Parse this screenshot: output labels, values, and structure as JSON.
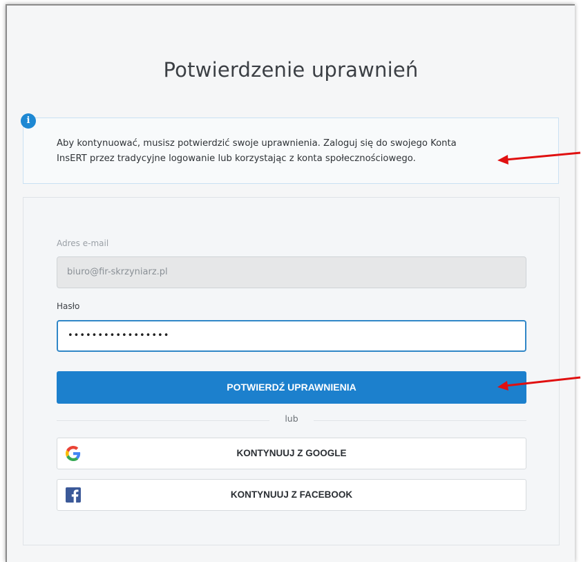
{
  "page": {
    "title": "Potwierdzenie uprawnień"
  },
  "info": {
    "icon": "info-icon",
    "line1": "Aby kontynuować, musisz potwierdzić swoje uprawnienia. Zaloguj się do swojego Konta",
    "line2": "InsERT przez tradycyjne logowanie lub korzystając z konta społecznościowego."
  },
  "form": {
    "email_label": "Adres e-mail",
    "email_value": "biuro@fir-skrzyniarz.pl",
    "password_label": "Hasło",
    "password_value": "•••••••••••••••••",
    "submit_label": "POTWIERDŹ UPRAWNIENIA",
    "or_text": "lub",
    "google_label": "KONTYNUUJ Z GOOGLE",
    "facebook_label": "KONTYNUUJ Z FACEBOOK"
  },
  "colors": {
    "accent": "#1c80cd",
    "annotation_arrow": "#e01010",
    "facebook": "#3b5998"
  }
}
